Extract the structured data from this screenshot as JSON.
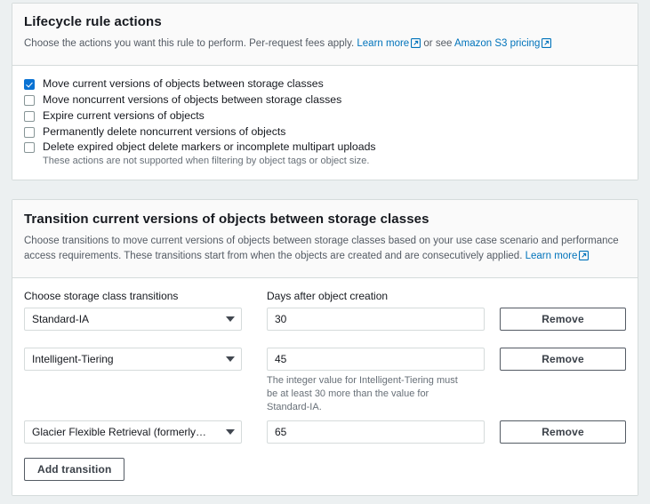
{
  "actions_section": {
    "title": "Lifecycle rule actions",
    "description_prefix": "Choose the actions you want this rule to perform. Per-request fees apply.",
    "learn_more_label": "Learn more",
    "description_middle": "or see",
    "pricing_link_label": "Amazon S3 pricing",
    "checkboxes": [
      {
        "label": "Move current versions of objects between storage classes",
        "checked": true
      },
      {
        "label": "Move noncurrent versions of objects between storage classes",
        "checked": false
      },
      {
        "label": "Expire current versions of objects",
        "checked": false
      },
      {
        "label": "Permanently delete noncurrent versions of objects",
        "checked": false
      },
      {
        "label": "Delete expired object delete markers or incomplete multipart uploads",
        "checked": false
      }
    ],
    "footnote": "These actions are not supported when filtering by object tags or object size."
  },
  "transition_section": {
    "title": "Transition current versions of objects between storage classes",
    "description": "Choose transitions to move current versions of objects between storage classes based on your use case scenario and performance access requirements. These transitions start from when the objects are created and are consecutively applied.",
    "learn_more_label": "Learn more",
    "column_headers": {
      "storage_class": "Choose storage class transitions",
      "days": "Days after object creation"
    },
    "rows": [
      {
        "storage_class": "Standard-IA",
        "days": "30",
        "remove_label": "Remove",
        "hint": ""
      },
      {
        "storage_class": "Intelligent-Tiering",
        "days": "45",
        "remove_label": "Remove",
        "hint": "The integer value for Intelligent-Tiering must be at least 30 more than the value for Standard-IA."
      },
      {
        "storage_class": "Glacier Flexible Retrieval (formerly…",
        "days": "65",
        "remove_label": "Remove",
        "hint": ""
      }
    ],
    "add_transition_label": "Add transition"
  },
  "colors": {
    "link": "#0073bb",
    "checkbox_checked": "#0972d3",
    "page_background": "#ecf0f1",
    "card_background": "#ffffff",
    "header_background": "#fafafa",
    "border": "#d5dbdb",
    "muted_text": "#545b64"
  }
}
